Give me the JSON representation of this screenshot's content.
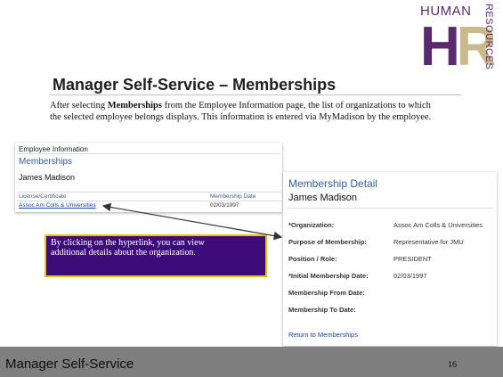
{
  "logo": {
    "top": "HUMAN",
    "side": "RESOURCES",
    "letters_h": "H",
    "letters_r": "R"
  },
  "slide": {
    "title": "Manager Self-Service – Memberships",
    "intro_prefix": "After selecting ",
    "intro_bold": "Memberships",
    "intro_suffix": " from the Employee Information page, the list of organizations to which the selected employee belongs displays. This information is entered via MyMadison by the employee."
  },
  "employee_panel": {
    "breadcrumb": "Employee Information",
    "header": "Memberships",
    "employee_name": "James Madison",
    "columns": [
      "License/Certificate",
      "Membership Date"
    ],
    "rows": [
      {
        "organization": "Assoc Am Colls & Universities",
        "date": "02/03/1997"
      }
    ]
  },
  "membership_detail": {
    "title": "Membership Detail",
    "employee_name": "James Madison",
    "fields": [
      {
        "label": "*Organization:",
        "value": "Assoc Am Colls & Universities"
      },
      {
        "label": "Purpose of Membership:",
        "value": "Representative for JMU"
      },
      {
        "label": "Position / Role:",
        "value": "PRESIDENT"
      },
      {
        "label": "*Initial Membership Date:",
        "value": "02/03/1997"
      },
      {
        "label": "Membership From Date:",
        "value": ""
      },
      {
        "label": "Membership To Date:",
        "value": ""
      }
    ],
    "return_link": "Return to Memberships"
  },
  "callout": {
    "text": "By clicking on the hyperlink, you can view additional details about the organization."
  },
  "footer": {
    "title": "Manager Self-Service",
    "page_number": "16"
  },
  "colors": {
    "footer_bg": "#7f7f7f",
    "callout_bg": "#3d0a7a",
    "callout_border": "#f0c000",
    "logo_purple": "#5b2a6e",
    "logo_tan": "#c9b98b",
    "link_blue": "#1a3fa8"
  }
}
